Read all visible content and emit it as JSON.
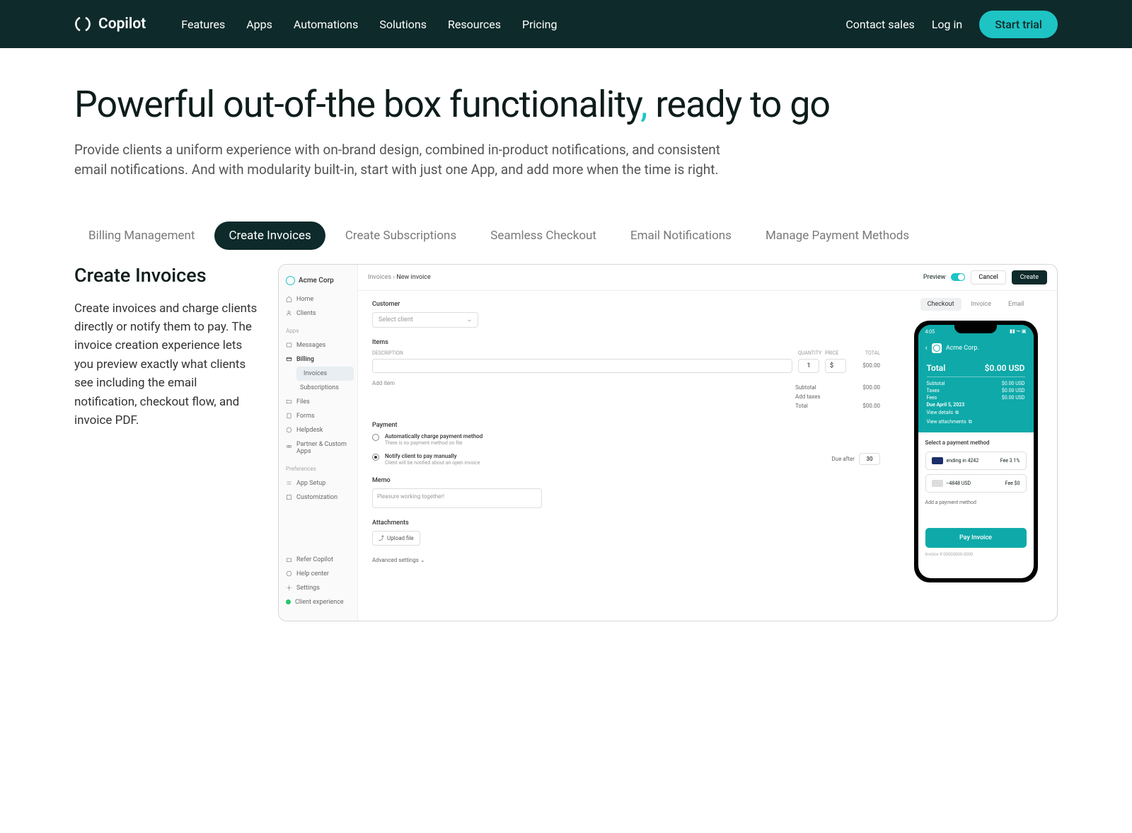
{
  "header": {
    "logo": "Copilot",
    "nav": [
      "Features",
      "Apps",
      "Automations",
      "Solutions",
      "Resources",
      "Pricing"
    ],
    "contact": "Contact sales",
    "login": "Log in",
    "trial": "Start trial"
  },
  "hero": {
    "title_a": "Powerful out-of-the box functionality",
    "comma": ",",
    "title_b": " ready to go",
    "subtitle": "Provide clients a uniform experience with on-brand design, combined in-product notifications, and consistent email notifications. And with modularity built-in, start with just one App, and add more when the time is right."
  },
  "tabs": [
    "Billing Management",
    "Create Invoices",
    "Create Subscriptions",
    "Seamless Checkout",
    "Email Notifications",
    "Manage Payment Methods"
  ],
  "panel": {
    "title": "Create Invoices",
    "desc": "Create invoices and charge clients directly or notify them to pay. The invoice creation experience lets you preview exactly what clients see including the email notification, checkout flow, and invoice PDF."
  },
  "screenshot": {
    "company": "Acme Corp",
    "nav_home": "Home",
    "nav_clients": "Clients",
    "apps_label": "Apps",
    "nav_messages": "Messages",
    "nav_billing": "Billing",
    "nav_invoices": "Invoices",
    "nav_subscriptions": "Subscriptions",
    "nav_files": "Files",
    "nav_forms": "Forms",
    "nav_helpdesk": "Helpdesk",
    "nav_partner": "Partner & Custom Apps",
    "pref_label": "Preferences",
    "nav_appsetup": "App Setup",
    "nav_custom": "Customization",
    "nav_refer": "Refer Copilot",
    "nav_helpcenter": "Help center",
    "nav_settings": "Settings",
    "nav_clientexp": "Client experience",
    "breadcrumb_a": "Invoices",
    "breadcrumb_sep": "›",
    "breadcrumb_b": "New invoice",
    "preview_label": "Preview",
    "cancel": "Cancel",
    "create": "Create",
    "f_customer": "Customer",
    "f_select_client": "Select client",
    "f_items": "Items",
    "col_desc": "DESCRIPTION",
    "col_qty": "QUANTITY",
    "col_price": "PRICE",
    "col_total": "TOTAL",
    "qty_val": "1",
    "price_val": "$",
    "row_total": "$00.00",
    "add_item": "Add item",
    "sum_subtotal": "Subtotal",
    "sum_subtotal_v": "$00.00",
    "sum_taxes": "Add taxes",
    "sum_total": "Total",
    "sum_total_v": "$00.00",
    "f_payment": "Payment",
    "pay_auto": "Automatically charge payment method",
    "pay_auto_sub": "There is no payment method on file",
    "pay_notify": "Notify client to pay manually",
    "pay_notify_sub": "Client will be notified about an open invoice",
    "due_after": "Due after",
    "due_days": "30",
    "f_memo": "Memo",
    "memo_placeholder": "Pleasure working together!",
    "f_attach": "Attachments",
    "upload": "Upload file",
    "adv": "Advanced settings",
    "preview_tabs": [
      "Checkout",
      "Invoice",
      "Email"
    ],
    "phone": {
      "time": "4:05",
      "corp": "Acme Corp.",
      "total_label": "Total",
      "total_val": "$0.00 USD",
      "subtotal": "Subtotal",
      "subtotal_v": "$0.00 USD",
      "taxes": "Taxes",
      "taxes_v": "$0.00 USD",
      "fees": "Fees",
      "fees_v": "$0.00 USD",
      "due": "Due April 5, 2023",
      "view_details": "View details",
      "view_attach": "View attachments",
      "select_pm": "Select a payment method",
      "pm1": "ending in 4242",
      "pm1_fee": "Fee 3.1%",
      "pm2": "--4848 USD",
      "pm2_fee": "Fee $0",
      "add_pm": "Add a payment method",
      "pay_btn": "Pay Invoice",
      "inv_num": "Invoice # 00000000-0000"
    }
  }
}
